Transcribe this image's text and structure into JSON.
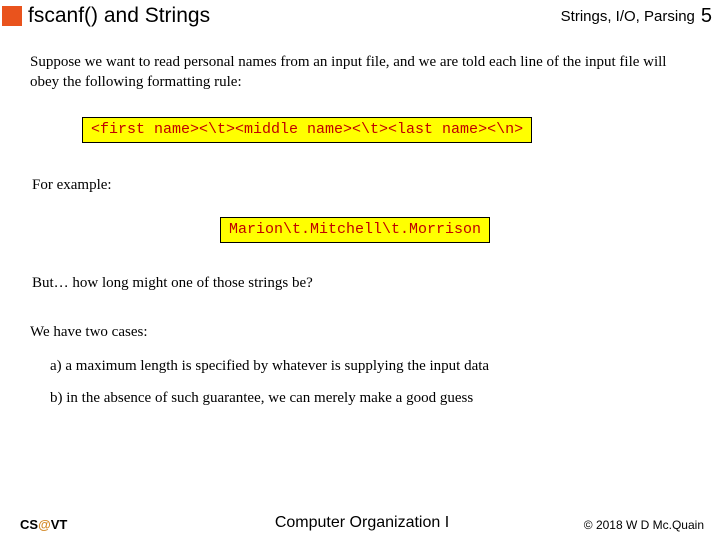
{
  "header": {
    "title": "fscanf() and Strings",
    "breadcrumb": "Strings, I/O, Parsing",
    "pagenum": "5"
  },
  "body": {
    "intro": "Suppose we want to read personal names from an input file, and we are told each line of the input file will obey the following formatting rule:",
    "format_rule": "<first name><\\t><middle name><\\t><last name><\\n>",
    "for_example_label": "For example:",
    "example": "Marion\\t.Mitchell\\t.Morrison",
    "but_question": "But… how long might one of those strings be?",
    "cases_intro": "We have two cases:",
    "case_a": "a)  a maximum length is specified by whatever is supplying the input data",
    "case_b": "b)  in the absence of such guarantee, we can merely make a good guess"
  },
  "footer": {
    "left_cs": "CS",
    "left_at": "@",
    "left_vt": "VT",
    "center": "Computer Organization I",
    "right": "© 2018 W D Mc.Quain"
  }
}
